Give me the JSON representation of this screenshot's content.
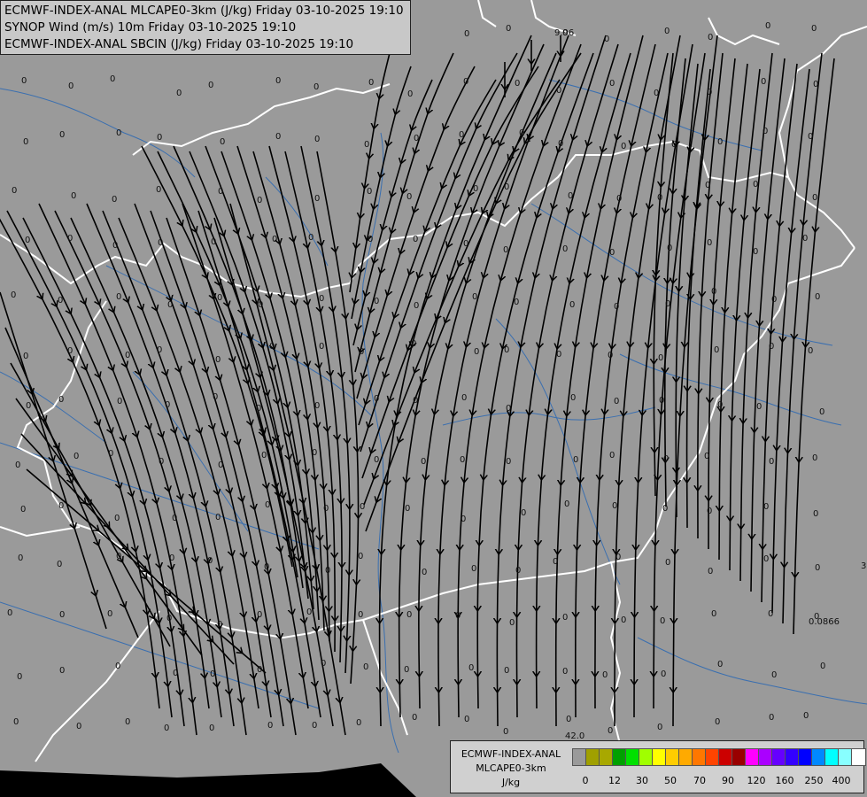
{
  "header": {
    "line1": "ECMWF-INDEX-ANAL MLCAPE0-3km (J/kg) Friday 03-10-2025 19:10",
    "line2": "SYNOP Wind (m/s) 10m Friday 03-10-2025 19:10",
    "line3": "ECMWF-INDEX-ANAL SBCIN (J/kg) Friday 03-10-2025 19:10"
  },
  "legend": {
    "title1": "ECMWF-INDEX-ANAL",
    "title2": "MLCAPE0-3km",
    "unit": "J/kg",
    "tick_labels": [
      "0",
      "12",
      "30",
      "50",
      "70",
      "90",
      "120",
      "160",
      "250",
      "400"
    ],
    "colors": [
      "#9a9a9a",
      "#a0a000",
      "#a8a800",
      "#00a000",
      "#00e000",
      "#a0ff00",
      "#ffff00",
      "#ffcc00",
      "#ffaa00",
      "#ff7700",
      "#ff4400",
      "#cc0000",
      "#990000",
      "#ff00ff",
      "#aa00ff",
      "#6600ff",
      "#3300ff",
      "#0000ff",
      "#0088ff",
      "#00ffff",
      "#88ffff",
      "#ffffff"
    ]
  },
  "map": {
    "colors": {
      "background": "#9a9a9a",
      "border": "#ffffff",
      "river": "#3a6fb0",
      "streamline": "#000000",
      "sea": "#000000"
    },
    "labels": [
      {
        "id": "l1",
        "text": "9.96"
      },
      {
        "id": "l2",
        "text": "0.0866"
      },
      {
        "id": "l3",
        "text": "42.0"
      },
      {
        "id": "l4",
        "text": "3"
      }
    ],
    "zero_label": "0"
  }
}
